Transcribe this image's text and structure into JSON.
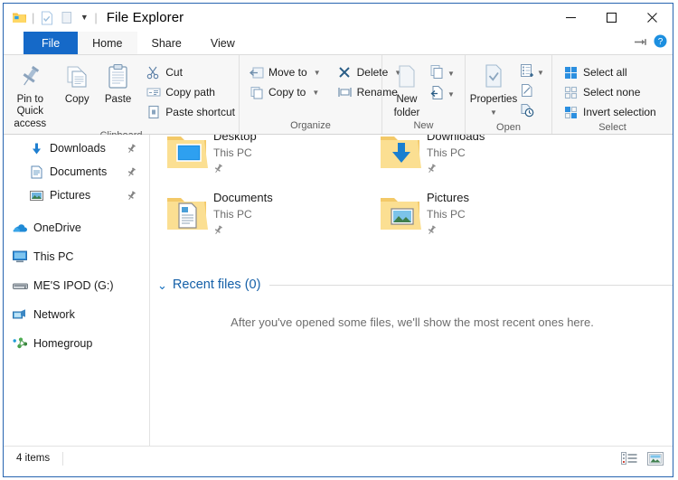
{
  "window": {
    "title": "File Explorer",
    "accent_color": "#1569c8",
    "border_color": "#2764b0"
  },
  "quick_access_toolbar": {
    "items": [
      {
        "name": "explorer-icon",
        "label": "File Explorer"
      },
      {
        "name": "properties-icon",
        "label": "Properties"
      },
      {
        "name": "new-folder-icon",
        "label": "New folder"
      }
    ],
    "customize_label": "Customize Quick Access Toolbar"
  },
  "window_controls": {
    "minimize": "Minimize",
    "maximize": "Maximize",
    "close": "Close"
  },
  "ribbon_controls": {
    "collapse_label": "Minimize the Ribbon",
    "help_label": "Help"
  },
  "tabs": [
    {
      "label": "File",
      "id": "file",
      "state": "file"
    },
    {
      "label": "Home",
      "id": "home",
      "state": "active"
    },
    {
      "label": "Share",
      "id": "share",
      "state": "normal"
    },
    {
      "label": "View",
      "id": "view",
      "state": "normal"
    }
  ],
  "ribbon": {
    "groups": [
      {
        "id": "clipboard",
        "label": "Clipboard",
        "big_buttons": [
          {
            "id": "pin-to-quick-access",
            "label_line1": "Pin to Quick",
            "label_line2": "access",
            "icon": "pin-icon"
          },
          {
            "id": "copy",
            "label_line1": "Copy",
            "label_line2": "",
            "icon": "copy-icon"
          },
          {
            "id": "paste",
            "label_line1": "Paste",
            "label_line2": "",
            "icon": "clipboard-icon"
          }
        ],
        "small_buttons": [
          {
            "id": "cut",
            "label": "Cut",
            "icon": "scissors-icon"
          },
          {
            "id": "copy-path",
            "label": "Copy path",
            "icon": "copy-path-icon"
          },
          {
            "id": "paste-shortcut",
            "label": "Paste shortcut",
            "icon": "paste-shortcut-icon"
          }
        ]
      },
      {
        "id": "organize",
        "label": "Organize",
        "small_buttons": [
          {
            "id": "move-to",
            "label": "Move to",
            "icon": "move-to-icon",
            "has_caret": true
          },
          {
            "id": "copy-to",
            "label": "Copy to",
            "icon": "copy-to-icon",
            "has_caret": true
          },
          {
            "id": "delete",
            "label": "Delete",
            "icon": "delete-x-icon",
            "has_caret": true
          },
          {
            "id": "rename",
            "label": "Rename",
            "icon": "rename-icon",
            "has_caret": false
          }
        ]
      },
      {
        "id": "new",
        "label": "New",
        "big_buttons": [
          {
            "id": "new-folder",
            "label_line1": "New",
            "label_line2": "folder",
            "icon": "folder-icon"
          }
        ],
        "stack_buttons": [
          {
            "id": "new-item",
            "label": "New item",
            "icon": "new-item-icon",
            "has_caret": true
          },
          {
            "id": "easy-access",
            "label": "Easy access",
            "icon": "easy-access-icon",
            "has_caret": true
          }
        ]
      },
      {
        "id": "open",
        "label": "Open",
        "big_buttons": [
          {
            "id": "properties",
            "label_line1": "Properties",
            "label_line2": "",
            "icon": "properties-icon",
            "has_caret": true
          }
        ],
        "stack_buttons": [
          {
            "id": "open-with",
            "label": "Open",
            "icon": "open-icon",
            "has_caret": true
          },
          {
            "id": "edit",
            "label": "Edit",
            "icon": "edit-icon",
            "has_caret": false
          },
          {
            "id": "history",
            "label": "History",
            "icon": "history-icon",
            "has_caret": false
          }
        ]
      },
      {
        "id": "select",
        "label": "Select",
        "small_buttons": [
          {
            "id": "select-all",
            "label": "Select all",
            "icon": "select-all-icon"
          },
          {
            "id": "select-none",
            "label": "Select none",
            "icon": "select-none-icon"
          },
          {
            "id": "invert-selection",
            "label": "Invert selection",
            "icon": "invert-selection-icon"
          }
        ]
      }
    ]
  },
  "navigation_pane": {
    "items": [
      {
        "id": "downloads",
        "label": "Downloads",
        "icon": "download-arrow-icon",
        "indent": 2,
        "pinned": true
      },
      {
        "id": "documents",
        "label": "Documents",
        "icon": "document-icon",
        "indent": 2,
        "pinned": true
      },
      {
        "id": "pictures",
        "label": "Pictures",
        "icon": "picture-icon",
        "indent": 2,
        "pinned": true
      },
      {
        "id": "onedrive",
        "label": "OneDrive",
        "icon": "onedrive-cloud-icon",
        "indent": 1,
        "pinned": false
      },
      {
        "id": "this-pc",
        "label": "This PC",
        "icon": "monitor-icon",
        "indent": 1,
        "pinned": false
      },
      {
        "id": "mes-ipod",
        "label": "ME'S IPOD (G:)",
        "icon": "drive-icon",
        "indent": 1,
        "pinned": false
      },
      {
        "id": "network",
        "label": "Network",
        "icon": "network-icon",
        "indent": 1,
        "pinned": false
      },
      {
        "id": "homegroup",
        "label": "Homegroup",
        "icon": "homegroup-icon",
        "indent": 1,
        "pinned": false
      }
    ]
  },
  "main": {
    "frequent_folders": [
      {
        "id": "desktop",
        "name": "Desktop",
        "location": "This PC",
        "icon": "desktop-folder-icon",
        "pinned": true
      },
      {
        "id": "downloads",
        "name": "Downloads",
        "location": "This PC",
        "icon": "downloads-folder-icon",
        "pinned": true
      },
      {
        "id": "documents",
        "name": "Documents",
        "location": "This PC",
        "icon": "documents-folder-icon",
        "pinned": true
      },
      {
        "id": "pictures",
        "name": "Pictures",
        "location": "This PC",
        "icon": "pictures-folder-icon",
        "pinned": true
      }
    ],
    "recent_files": {
      "heading": "Recent files (0)",
      "expanded": true,
      "empty_message": "After you've opened some files, we'll show the most recent ones here."
    }
  },
  "status_bar": {
    "item_count": "4 items",
    "views": [
      {
        "id": "details-view",
        "label": "Details view",
        "selected": false
      },
      {
        "id": "large-icons-view",
        "label": "Large icons view",
        "selected": false
      }
    ]
  }
}
